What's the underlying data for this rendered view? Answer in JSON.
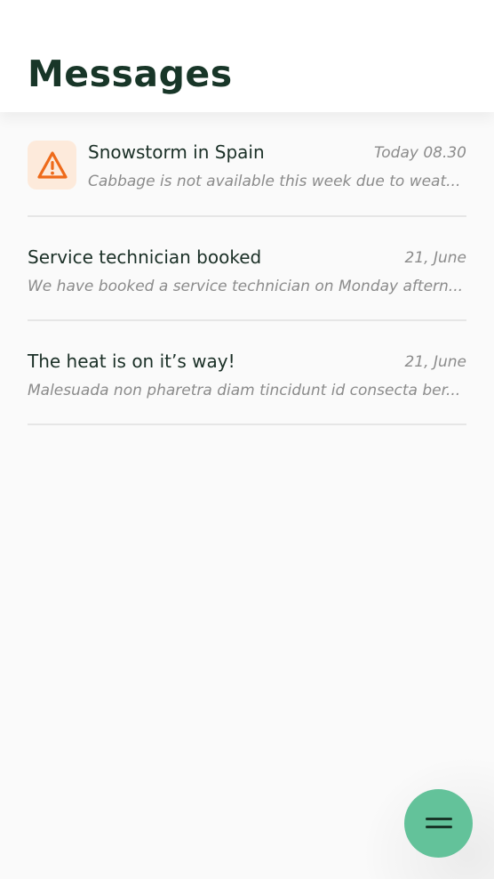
{
  "header": {
    "title": "Messages"
  },
  "messages": [
    {
      "title": "Snowstorm in Spain",
      "date": "Today 08.30",
      "preview": "Cabbage is not available this week due to weat...",
      "icon": "warning-icon"
    },
    {
      "title": "Service technician booked",
      "date": "21, June",
      "preview": "We have booked a service technician on Monday aftern..."
    },
    {
      "title": "The heat is on it’s way!",
      "date": "21, June",
      "preview": "Malesuada non pharetra diam tincidunt id consecta ber..."
    }
  ],
  "fab": {
    "icon": "menu-icon",
    "color": "#63c29a"
  },
  "colors": {
    "title": "#183628",
    "warning": "#ee6a1a",
    "warning_bg": "#fdeadb",
    "muted": "#8b8b8b"
  }
}
